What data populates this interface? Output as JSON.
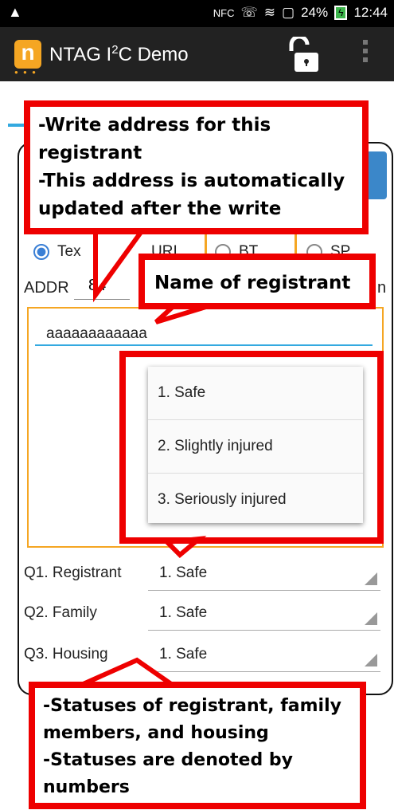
{
  "status_bar": {
    "warning_icon": "warning-icon",
    "nfc": "NFC",
    "battery": "24%",
    "time": "12:44"
  },
  "app": {
    "title_main": "NTAG I",
    "title_sup": "2",
    "title_end": "C Demo",
    "logo_letter": "n"
  },
  "radios": {
    "text": "Tex",
    "url": "URI",
    "bt": "BT",
    "sp": "SP"
  },
  "addr": {
    "label": "ADDR",
    "value": "84",
    "trailing": "n"
  },
  "text_input": {
    "value": "aaaaaaaaaaaa"
  },
  "dropdown": {
    "options": [
      "1. Safe",
      "2. Slightly injured",
      "3. Seriously injured"
    ]
  },
  "questions": [
    {
      "label": "Q1. Registrant",
      "value": "1. Safe"
    },
    {
      "label": "Q2. Family",
      "value": "1. Safe"
    },
    {
      "label": "Q3. Housing",
      "value": "1. Safe"
    }
  ],
  "callouts": {
    "address_line1": "-Write address for this",
    "address_line2": "registrant",
    "address_line3": "-This address is automatically",
    "address_line4": "updated after the write",
    "name": "Name of registrant",
    "status_line1": "-Statuses of registrant, family",
    "status_line2": "members, and housing",
    "status_line3": "-Statuses are denoted by",
    "status_line4": "numbers"
  },
  "colors": {
    "accent": "#33a9e0",
    "highlight": "#f5a623",
    "callout_red": "#e00000"
  }
}
